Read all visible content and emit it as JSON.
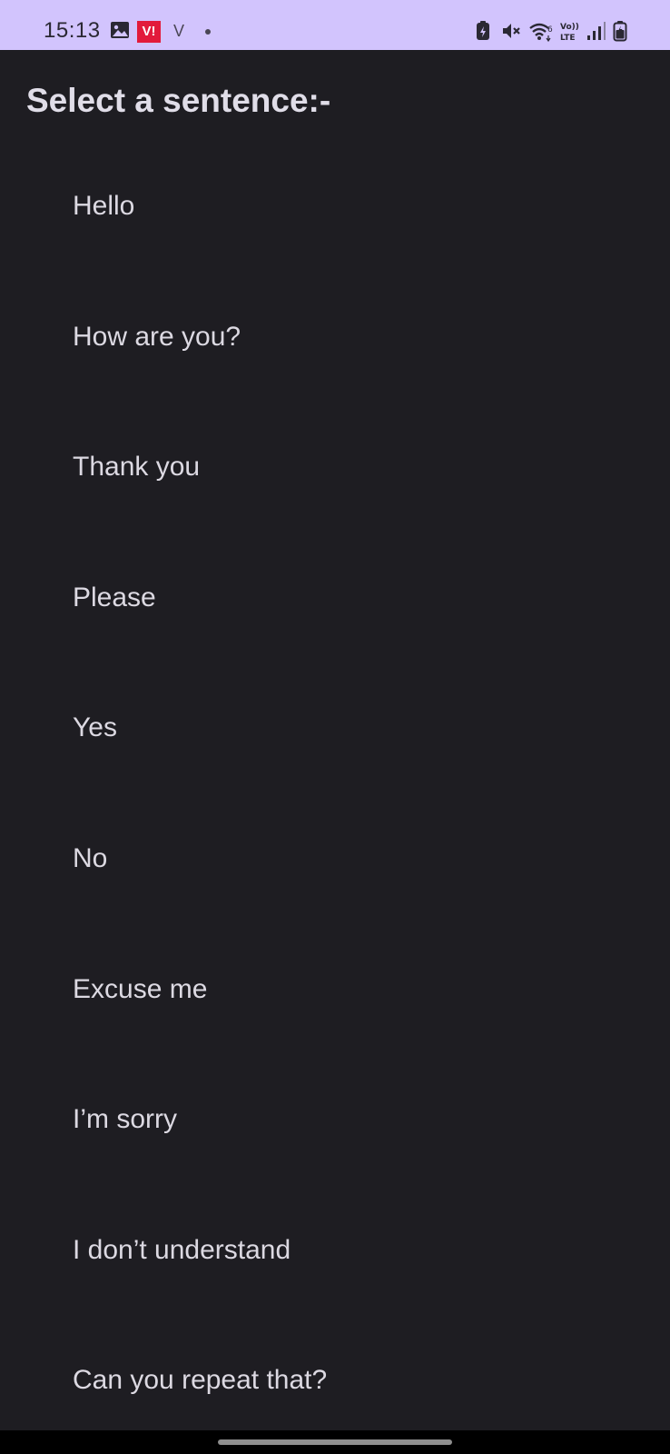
{
  "status_bar": {
    "time": "15:13",
    "carrier_badge": "V!",
    "carrier_letter": "V",
    "background": "#d2c4fd",
    "icons_left": [
      "gallery-icon",
      "vi-carrier-icon",
      "v-app-icon",
      "notification-dot-icon"
    ],
    "icons_right": [
      "battery-saver-icon",
      "mute-icon",
      "wifi-6-icon",
      "volte-icon",
      "signal-icon",
      "battery-icon"
    ]
  },
  "page": {
    "title": "Select a sentence:-",
    "background": "#1e1d22"
  },
  "sentences": [
    "Hello",
    "How are you?",
    "Thank you",
    "Please",
    "Yes",
    "No",
    "Excuse me",
    "I’m sorry",
    "I don’t understand",
    "Can you repeat that?"
  ]
}
